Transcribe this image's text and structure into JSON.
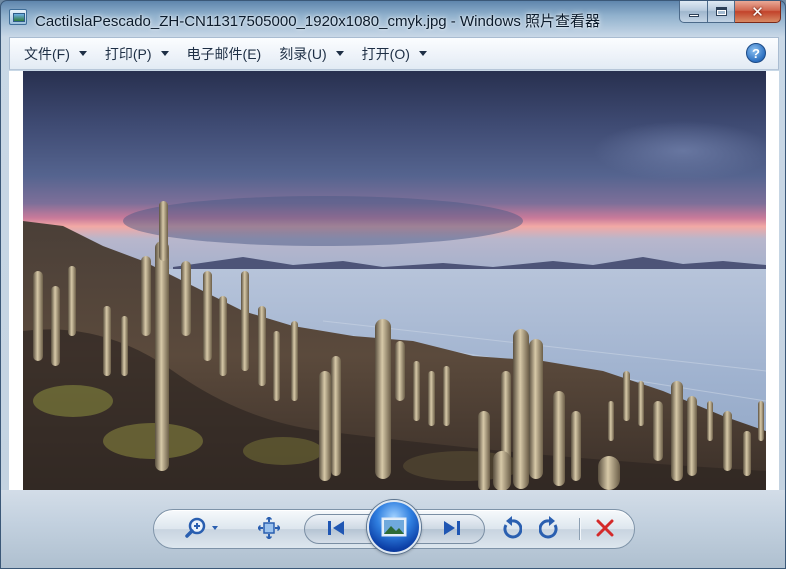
{
  "window": {
    "title": "CactiIslaPescado_ZH-CN11317505000_1920x1080_cmyk.jpg - Windows 照片查看器"
  },
  "menu": {
    "items": [
      {
        "label": "文件(F)",
        "has_arrow": true
      },
      {
        "label": "打印(P)",
        "has_arrow": true
      },
      {
        "label": "电子邮件(E)",
        "has_arrow": false
      },
      {
        "label": "刻录(U)",
        "has_arrow": true
      },
      {
        "label": "打开(O)",
        "has_arrow": true
      }
    ],
    "help_label": "?"
  },
  "controls": {
    "icons": [
      "zoom-icon",
      "actual-size-icon",
      "previous-icon",
      "slideshow-icon",
      "next-icon",
      "rotate-counterclockwise-icon",
      "rotate-clockwise-icon",
      "delete-icon"
    ]
  },
  "colors": {
    "accent": "#2f7fe0",
    "delete": "#d42a2a",
    "icon_blue": "#2a5fb0"
  }
}
